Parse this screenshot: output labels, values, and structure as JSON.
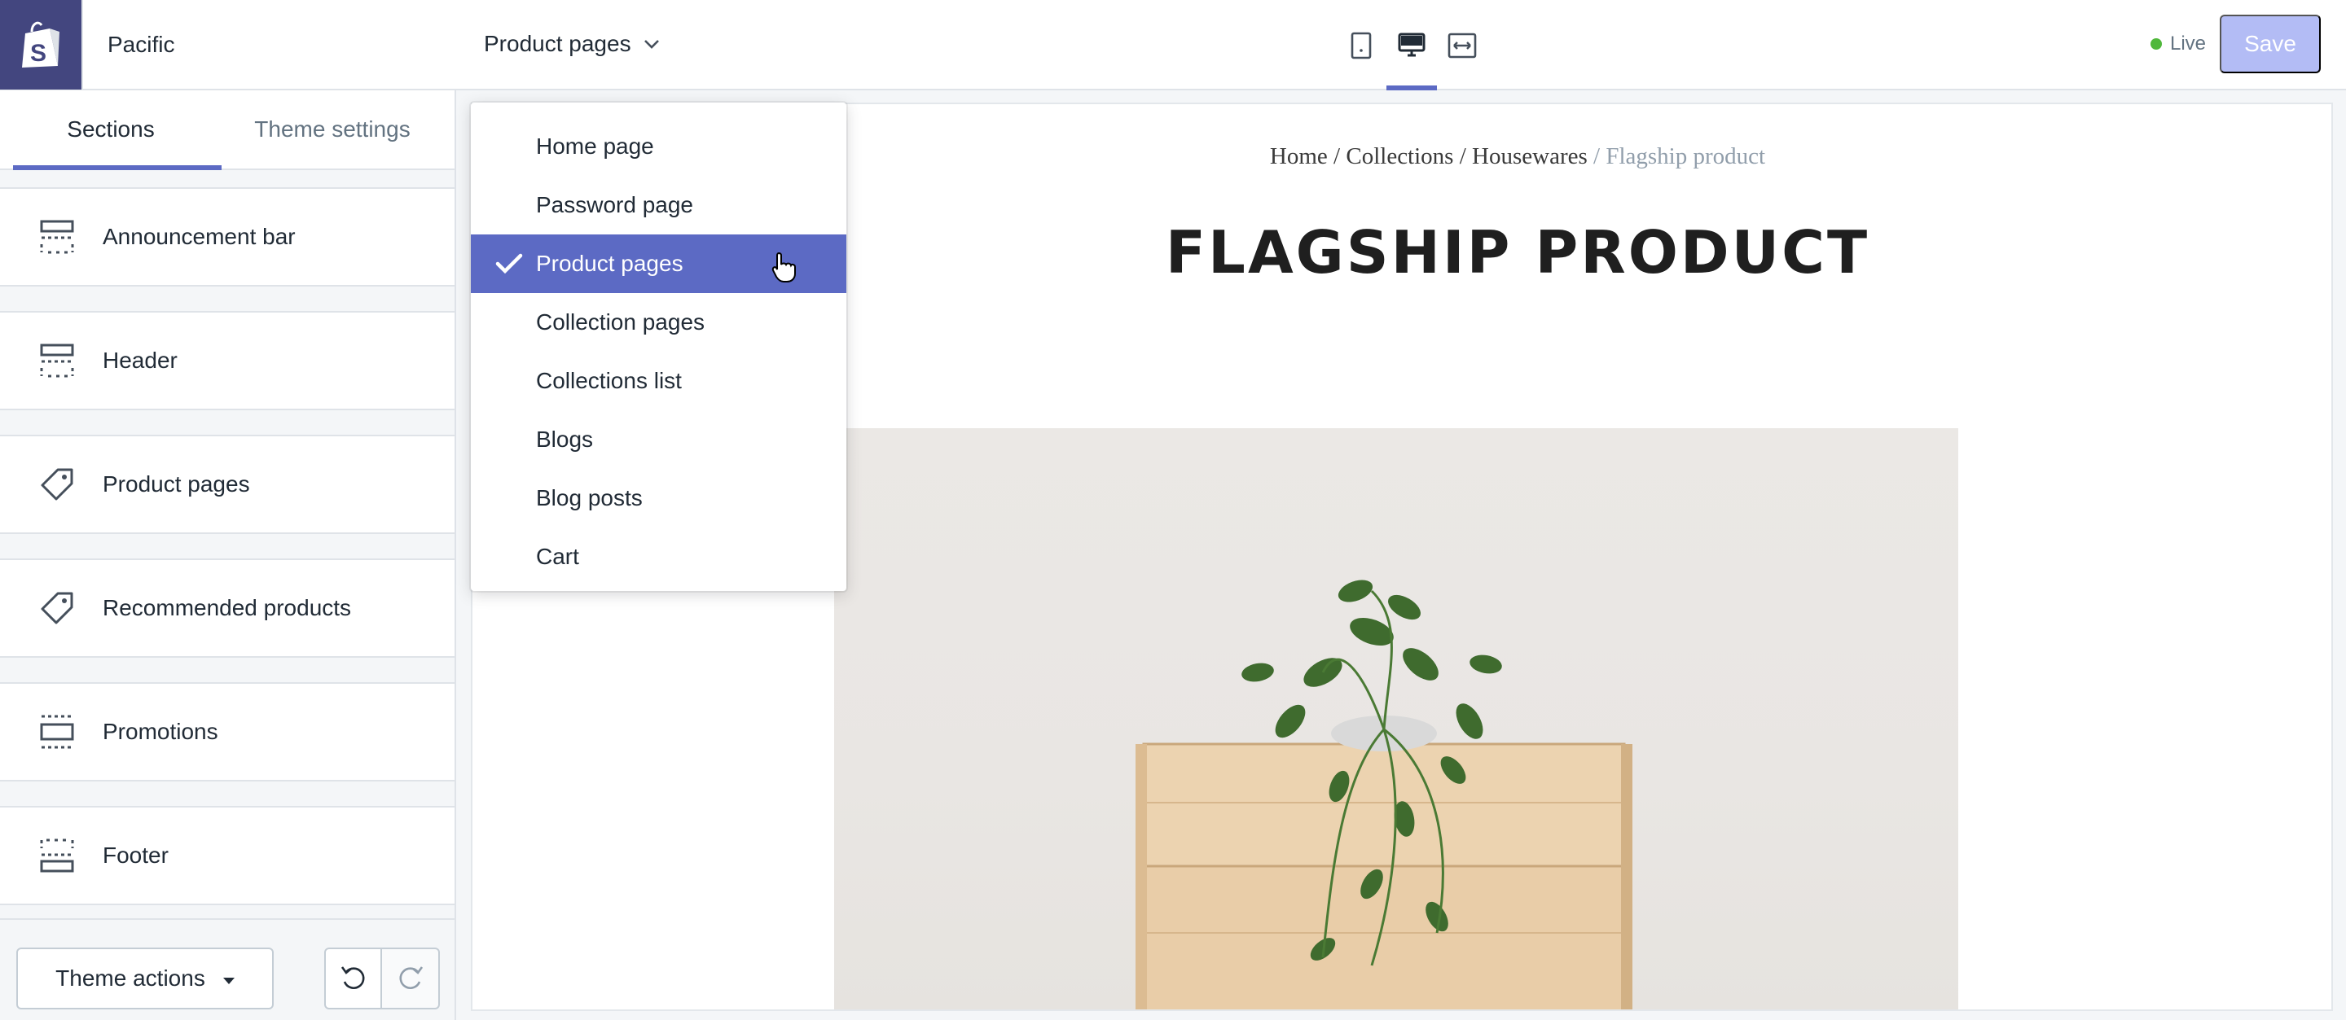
{
  "store": {
    "name": "Pacific"
  },
  "sidebar": {
    "tabs": [
      {
        "label": "Sections",
        "active": true
      },
      {
        "label": "Theme settings",
        "active": false
      }
    ],
    "sections": [
      {
        "label": "Announcement bar",
        "icon": "section-layout-top-icon"
      },
      {
        "label": "Header",
        "icon": "section-layout-top-icon"
      },
      {
        "label": "Product pages",
        "icon": "tag-icon"
      },
      {
        "label": "Recommended products",
        "icon": "tag-icon"
      },
      {
        "label": "Promotions",
        "icon": "section-layout-middle-icon"
      },
      {
        "label": "Footer",
        "icon": "section-layout-bottom-icon"
      }
    ],
    "footer": {
      "theme_actions_label": "Theme actions"
    }
  },
  "topbar": {
    "page_picker_label": "Product pages",
    "viewports": [
      "mobile-icon",
      "desktop-icon",
      "fullscreen-icon"
    ],
    "active_viewport": "desktop-icon",
    "status_label": "Live",
    "save_label": "Save"
  },
  "dropdown": {
    "items": [
      {
        "label": "Home page"
      },
      {
        "label": "Password page"
      },
      {
        "label": "Product pages",
        "selected": true
      },
      {
        "label": "Collection pages"
      },
      {
        "label": "Collections list"
      },
      {
        "label": "Blogs"
      },
      {
        "label": "Blog posts"
      },
      {
        "label": "Cart"
      }
    ]
  },
  "preview": {
    "breadcrumb": {
      "home": "Home",
      "collections": "Collections",
      "housewares": "Housewares",
      "current": "Flagship product",
      "separator": "/"
    },
    "product_title": "FLAGSHIP PRODUCT"
  },
  "colors": {
    "brand_logo_bg": "#43467f",
    "accent": "#5c6ac4",
    "save_disabled": "#b3bcf5",
    "live_dot": "#50b83c"
  }
}
